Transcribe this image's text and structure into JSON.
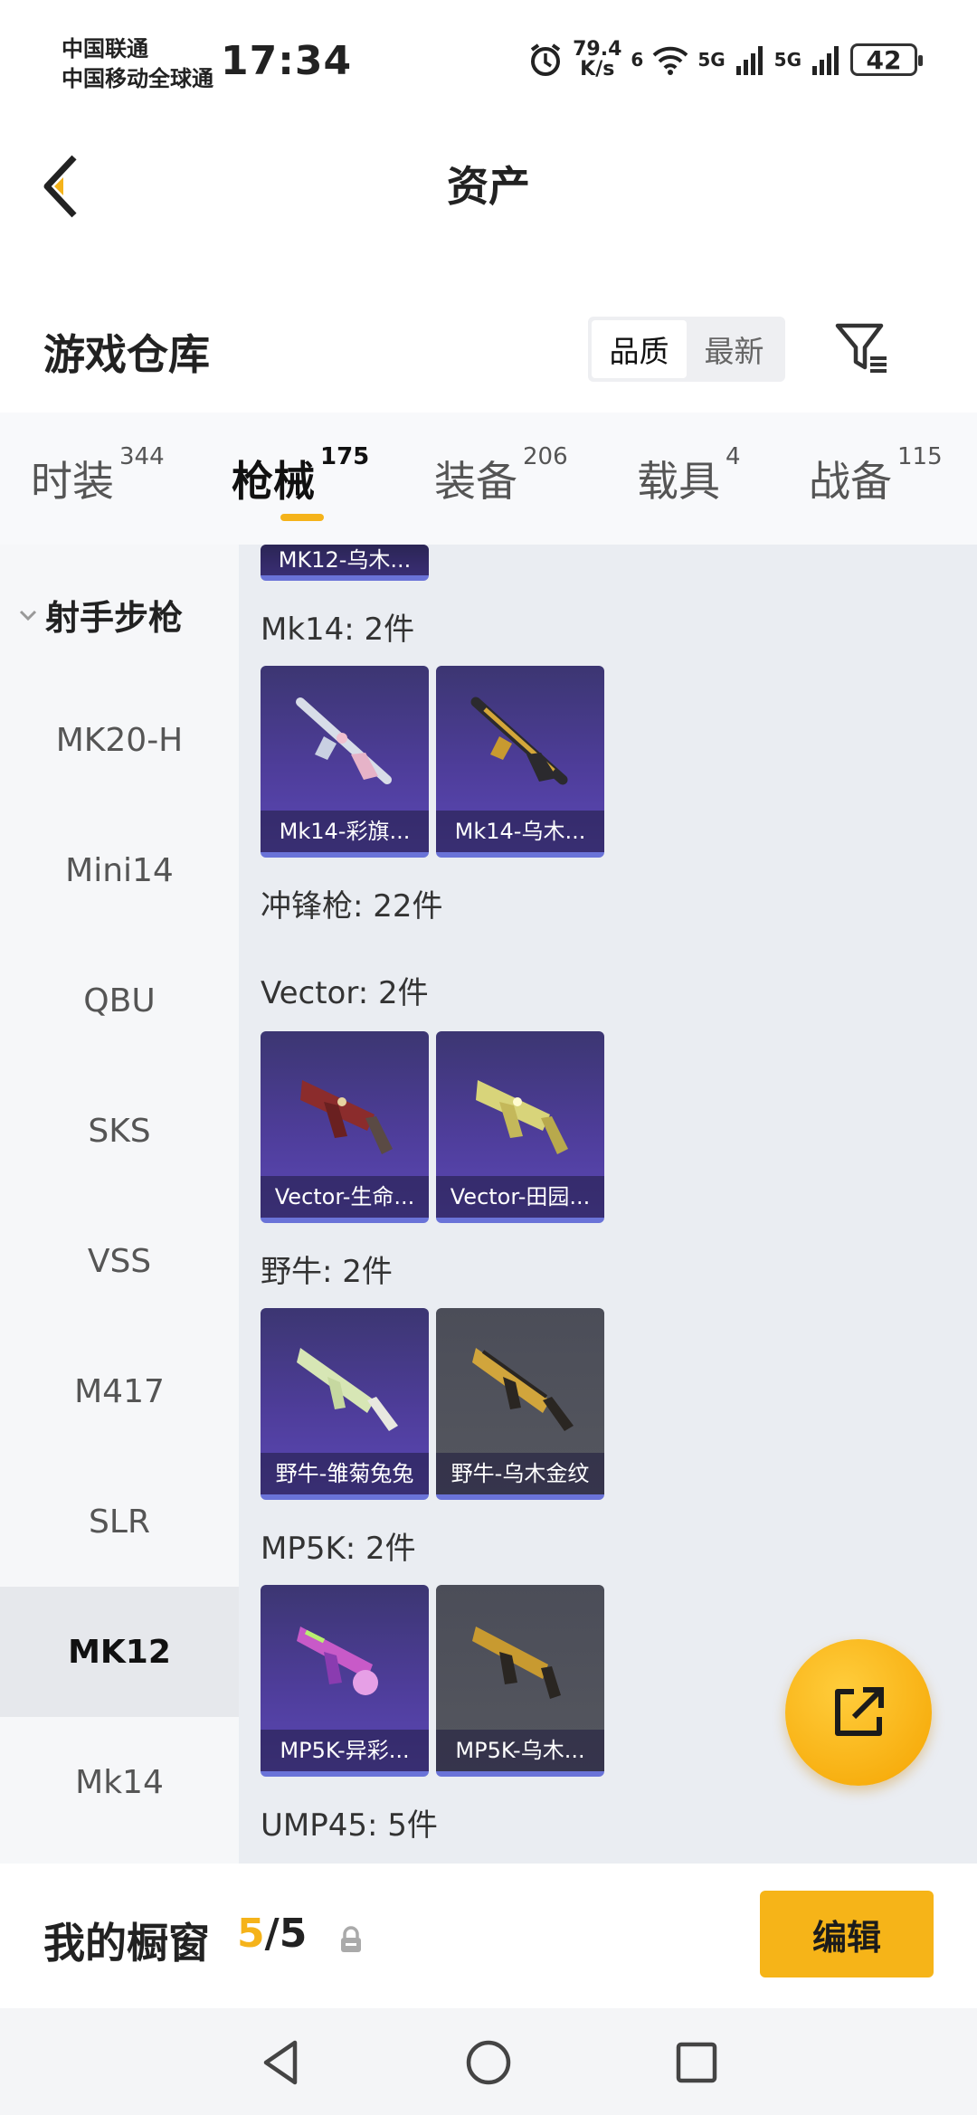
{
  "status_bar": {
    "carrier_1": "中国联通",
    "carrier_2": "中国移动全球通",
    "time": "17:34",
    "net_speed_value": "79.4",
    "net_speed_unit": "K/s",
    "wifi_label": "6",
    "sim1_label": "5G",
    "sim2_label": "5G",
    "battery": "42"
  },
  "header": {
    "title": "资产"
  },
  "warehouse": {
    "title": "游戏仓库",
    "sort_options": [
      "品质",
      "最新"
    ],
    "active_sort": "品质"
  },
  "tabs": [
    {
      "label": "时装",
      "count": "344"
    },
    {
      "label": "枪械",
      "count": "175"
    },
    {
      "label": "装备",
      "count": "206"
    },
    {
      "label": "载具",
      "count": "4"
    },
    {
      "label": "战备",
      "count": "115"
    }
  ],
  "active_tab": "枪械",
  "sidebar": {
    "group": "射手步枪",
    "items": [
      "MK20-H",
      "Mini14",
      "QBU",
      "SKS",
      "VSS",
      "M417",
      "SLR",
      "MK12",
      "Mk14"
    ],
    "active": "MK12"
  },
  "content": {
    "partial_card": "MK12-乌木...",
    "sections": [
      {
        "label": "Mk14: 2件",
        "cards": [
          "Mk14-彩旗...",
          "Mk14-乌木..."
        ]
      },
      {
        "label": "冲锋枪: 22件",
        "cards": []
      },
      {
        "label": "Vector: 2件",
        "cards": [
          "Vector-生命...",
          "Vector-田园..."
        ]
      },
      {
        "label": "野牛: 2件",
        "cards": [
          "野牛-雏菊兔兔",
          "野牛-乌木金纹"
        ]
      },
      {
        "label": "MP5K: 2件",
        "cards": [
          "MP5K-异彩...",
          "MP5K-乌木..."
        ]
      },
      {
        "label": "UMP45: 5件",
        "cards": []
      }
    ]
  },
  "showcase": {
    "title": "我的橱窗",
    "current": "5",
    "separator": "/",
    "total": "5",
    "edit_label": "编辑"
  },
  "colors": {
    "accent": "#f5b31a",
    "card_purple": "#4e3d9a",
    "card_gray": "#52545d"
  }
}
